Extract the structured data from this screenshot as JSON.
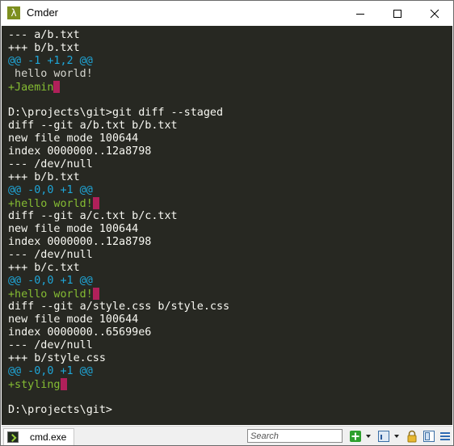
{
  "window": {
    "title": "Cmder",
    "app_icon_glyph": "λ"
  },
  "terminal": {
    "lines": [
      {
        "text": "--- a/b.txt",
        "color": "white"
      },
      {
        "text": "+++ b/b.txt",
        "color": "white"
      },
      {
        "text": "@@ -1 +1,2 @@",
        "color": "cyan"
      },
      {
        "text": " hello world!",
        "color": "gray"
      },
      {
        "text": "+Jaemin",
        "color": "green",
        "cursor": true
      },
      {
        "text": "",
        "color": "white"
      },
      {
        "text": "D:\\projects\\git>git diff --staged",
        "color": "white"
      },
      {
        "text": "diff --git a/b.txt b/b.txt",
        "color": "white"
      },
      {
        "text": "new file mode 100644",
        "color": "white"
      },
      {
        "text": "index 0000000..12a8798",
        "color": "white"
      },
      {
        "text": "--- /dev/null",
        "color": "white"
      },
      {
        "text": "+++ b/b.txt",
        "color": "white"
      },
      {
        "text": "@@ -0,0 +1 @@",
        "color": "cyan"
      },
      {
        "text": "+hello world!",
        "color": "green",
        "cursor": true
      },
      {
        "text": "diff --git a/c.txt b/c.txt",
        "color": "white"
      },
      {
        "text": "new file mode 100644",
        "color": "white"
      },
      {
        "text": "index 0000000..12a8798",
        "color": "white"
      },
      {
        "text": "--- /dev/null",
        "color": "white"
      },
      {
        "text": "+++ b/c.txt",
        "color": "white"
      },
      {
        "text": "@@ -0,0 +1 @@",
        "color": "cyan"
      },
      {
        "text": "+hello world!",
        "color": "green",
        "cursor": true
      },
      {
        "text": "diff --git a/style.css b/style.css",
        "color": "white"
      },
      {
        "text": "new file mode 100644",
        "color": "white"
      },
      {
        "text": "index 0000000..65699e6",
        "color": "white"
      },
      {
        "text": "--- /dev/null",
        "color": "white"
      },
      {
        "text": "+++ b/style.css",
        "color": "white"
      },
      {
        "text": "@@ -0,0 +1 @@",
        "color": "cyan"
      },
      {
        "text": "+styling",
        "color": "green",
        "cursor": true
      },
      {
        "text": "",
        "color": "white"
      },
      {
        "text": "D:\\projects\\git>",
        "color": "white"
      }
    ]
  },
  "statusbar": {
    "tab_label": "cmd.exe",
    "search_placeholder": "Search",
    "icons": [
      "new-console-icon",
      "dropdown-icon",
      "console-dropdown-icon",
      "lock-icon",
      "split-view-icon",
      "menu-icon"
    ]
  },
  "colors": {
    "terminal_bg": "#272822",
    "text": "#f8f8f2",
    "hunk_header": "#1fa6d8",
    "added_line": "#85bc33",
    "cursor": "#b0205a",
    "app_icon_bg": "#7d8f1e"
  }
}
